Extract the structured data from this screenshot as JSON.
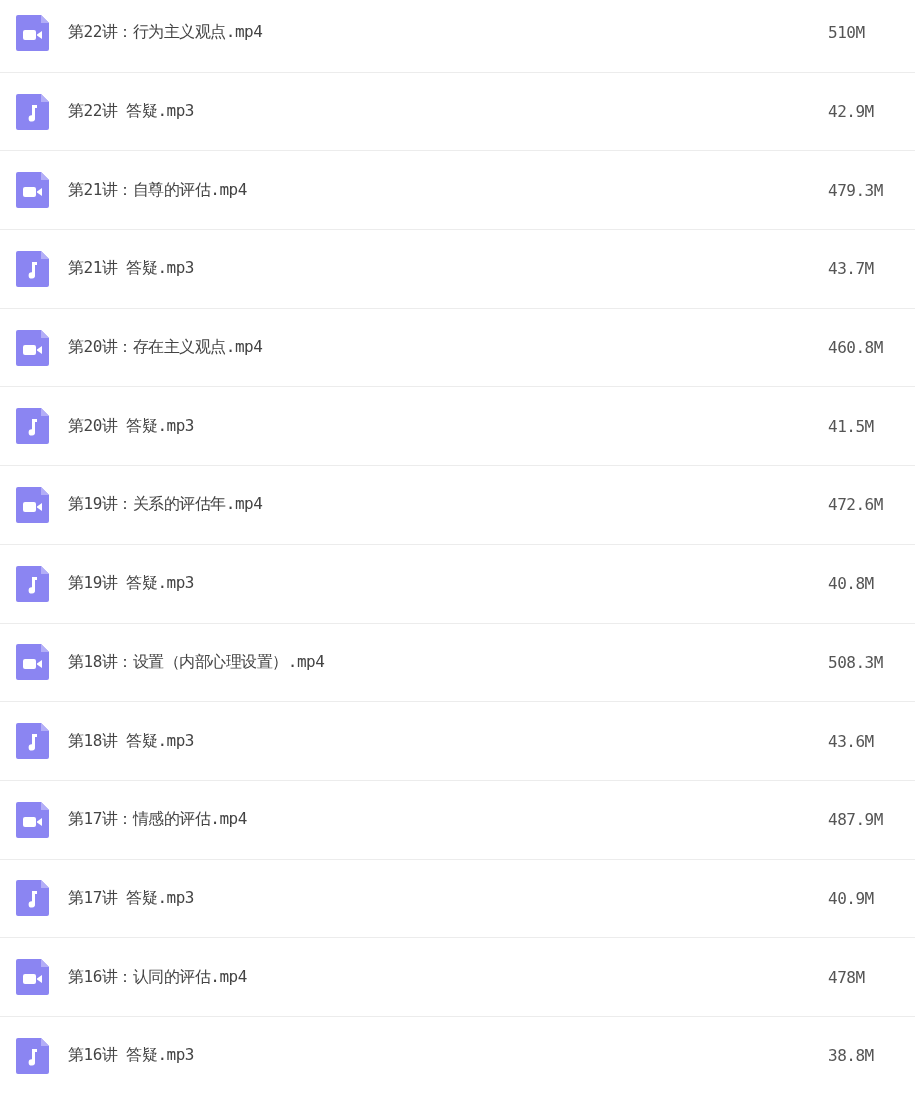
{
  "files": [
    {
      "kind": "video",
      "name": "第22讲：行为主义观点.mp4",
      "size": "510M"
    },
    {
      "kind": "audio",
      "name": "第22讲 答疑.mp3",
      "size": "42.9M"
    },
    {
      "kind": "video",
      "name": "第21讲：自尊的评估.mp4",
      "size": "479.3M"
    },
    {
      "kind": "audio",
      "name": "第21讲 答疑.mp3",
      "size": "43.7M"
    },
    {
      "kind": "video",
      "name": "第20讲：存在主义观点.mp4",
      "size": "460.8M"
    },
    {
      "kind": "audio",
      "name": "第20讲 答疑.mp3",
      "size": "41.5M"
    },
    {
      "kind": "video",
      "name": "第19讲：关系的评估年.mp4",
      "size": "472.6M"
    },
    {
      "kind": "audio",
      "name": "第19讲 答疑.mp3",
      "size": "40.8M"
    },
    {
      "kind": "video",
      "name": "第18讲：设置（内部心理设置）.mp4",
      "size": "508.3M"
    },
    {
      "kind": "audio",
      "name": "第18讲 答疑.mp3",
      "size": "43.6M"
    },
    {
      "kind": "video",
      "name": "第17讲：情感的评估.mp4",
      "size": "487.9M"
    },
    {
      "kind": "audio",
      "name": "第17讲 答疑.mp3",
      "size": "40.9M"
    },
    {
      "kind": "video",
      "name": "第16讲：认同的评估.mp4",
      "size": "478M"
    },
    {
      "kind": "audio",
      "name": "第16讲 答疑.mp3",
      "size": "38.8M"
    }
  ]
}
